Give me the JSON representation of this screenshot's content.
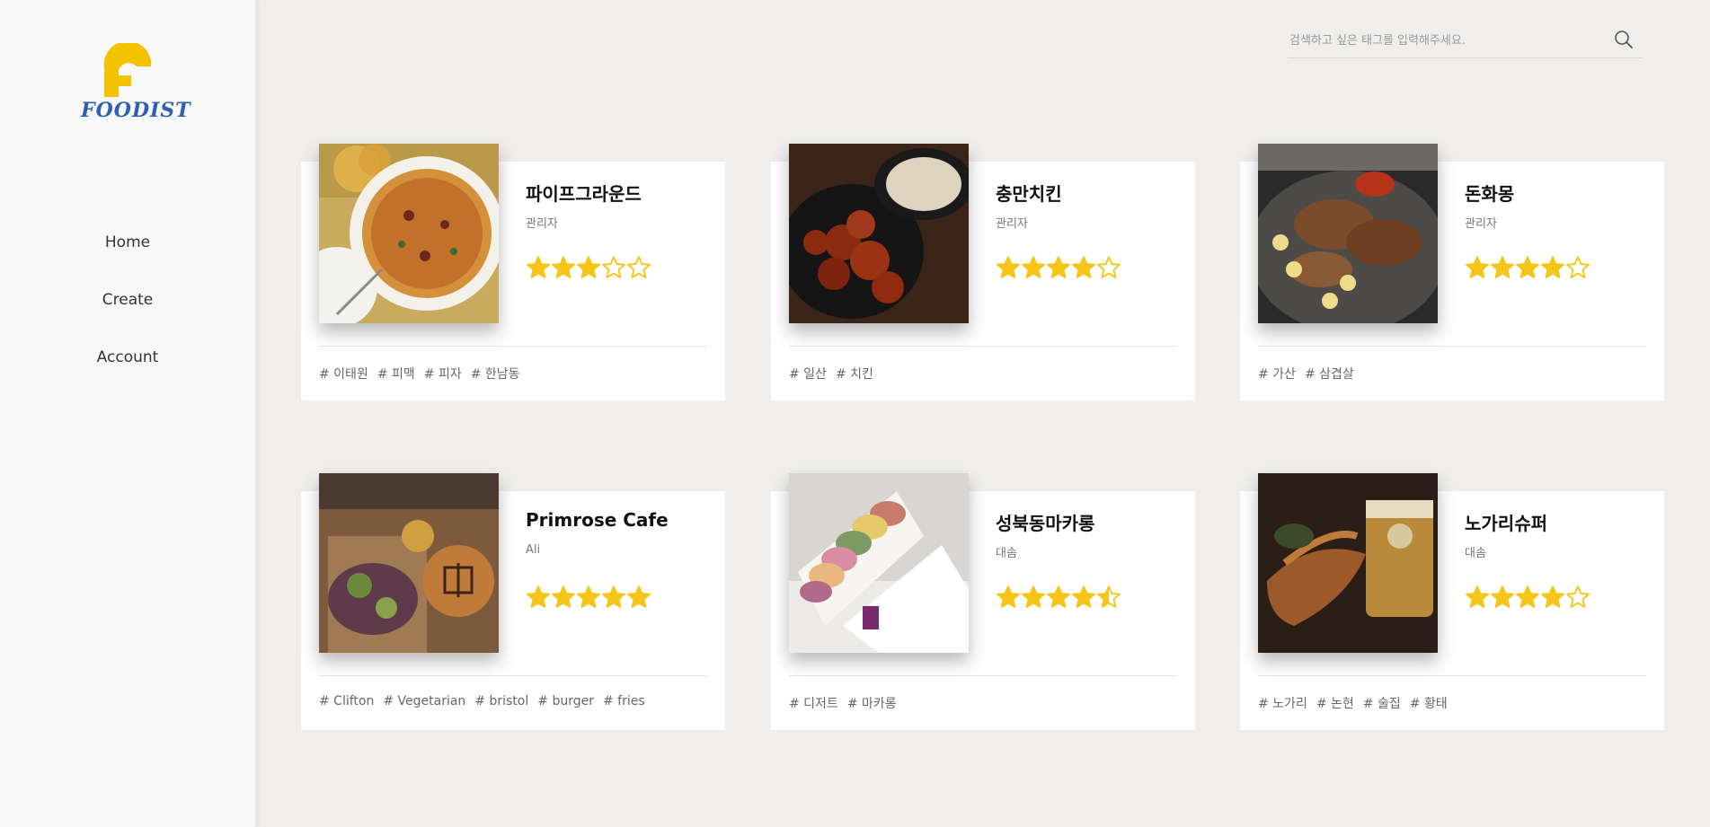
{
  "brand": {
    "name": "FOODIST",
    "colors": {
      "primary": "#f3c300",
      "text": "#2f5faf"
    }
  },
  "nav": {
    "items": [
      {
        "label": "Home"
      },
      {
        "label": "Create"
      },
      {
        "label": "Account"
      }
    ]
  },
  "search": {
    "placeholder": "검색하고 싶은 태그를 입력해주세요.",
    "value": ""
  },
  "star_color": "#f5c518",
  "cards": [
    {
      "title": "파이프그라운드",
      "author": "관리자",
      "rating": 3,
      "tags": [
        "# 이태원",
        "# 피맥",
        "# 피자",
        "# 한남동"
      ],
      "image": "pizza-photo"
    },
    {
      "title": "충만치킨",
      "author": "관리자",
      "rating": 4,
      "tags": [
        "# 일산",
        "# 치킨"
      ],
      "image": "fried-chicken-photo"
    },
    {
      "title": "돈화몽",
      "author": "관리자",
      "rating": 4,
      "tags": [
        "# 가산",
        "# 삼겹살"
      ],
      "image": "grilled-pork-photo"
    },
    {
      "title": "Primrose Cafe",
      "author": "Ali",
      "rating": 5,
      "tags": [
        "# Clifton",
        "# Vegetarian",
        "# bristol",
        "# burger",
        "# fries"
      ],
      "image": "burger-salad-photo"
    },
    {
      "title": "성북동마카롱",
      "author": "대솜",
      "rating": 4.5,
      "tags": [
        "# 디저트",
        "# 마카롱"
      ],
      "image": "macaron-box-photo"
    },
    {
      "title": "노가리슈퍼",
      "author": "대솜",
      "rating": 4,
      "tags": [
        "# 노가리",
        "# 논현",
        "# 술집",
        "# 황태"
      ],
      "image": "dried-fish-beer-photo"
    }
  ]
}
